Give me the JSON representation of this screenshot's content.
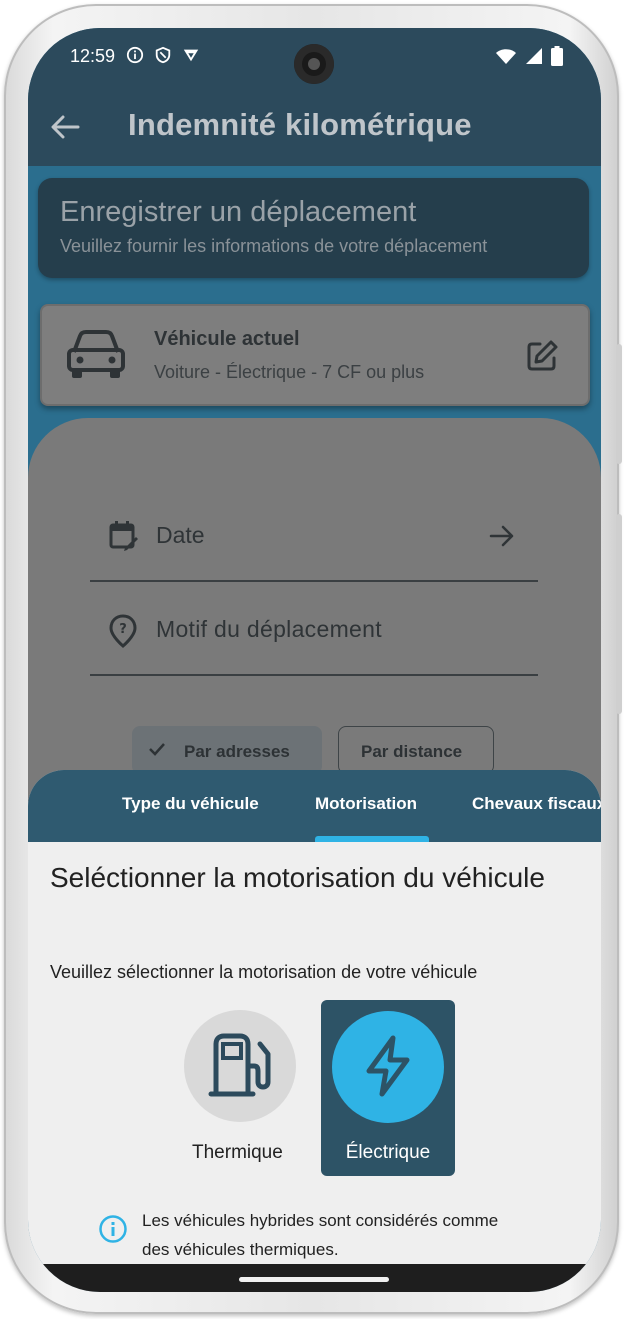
{
  "status_bar": {
    "time": "12:59",
    "icons_left": [
      "info-icon",
      "shield-icon",
      "vpn-icon"
    ],
    "icons_right": [
      "wifi-icon",
      "signal-icon",
      "battery-icon"
    ]
  },
  "app_bar": {
    "back_icon": "arrow-left-icon",
    "title": "Indemnité kilométrique"
  },
  "register_card": {
    "title": "Enregistrer un déplacement",
    "subtitle": "Veuillez fournir les informations de votre déplacement"
  },
  "vehicle_card": {
    "icon": "car-icon",
    "title": "Véhicule actuel",
    "subtitle": "Voiture - Électrique - 7 CF ou plus",
    "edit_icon": "edit-icon"
  },
  "form": {
    "date_label": "Date",
    "motif_label": "Motif du déplacement",
    "chip_addresses": "Par adresses",
    "chip_distance": "Par distance"
  },
  "sheet": {
    "tabs": [
      "Type du véhicule",
      "Motorisation",
      "Chevaux fiscaux"
    ],
    "active_tab": "Motorisation",
    "title": "Seléctionner la motorisation du véhicule",
    "subtitle": "Veuillez sélectionner la motorisation de votre véhicule",
    "options": [
      {
        "label": "Thermique",
        "icon": "fuel-pump-icon",
        "selected": false
      },
      {
        "label": "Électrique",
        "icon": "lightning-icon",
        "selected": true
      }
    ],
    "info_text": "Les véhicules hybrides sont considérés comme des véhicules thermiques."
  },
  "colors": {
    "accent": "#2fb3e5",
    "header": "#2c4a5c",
    "tabs_bg": "#2f5a70",
    "selected_option_bg": "#2d5366"
  }
}
